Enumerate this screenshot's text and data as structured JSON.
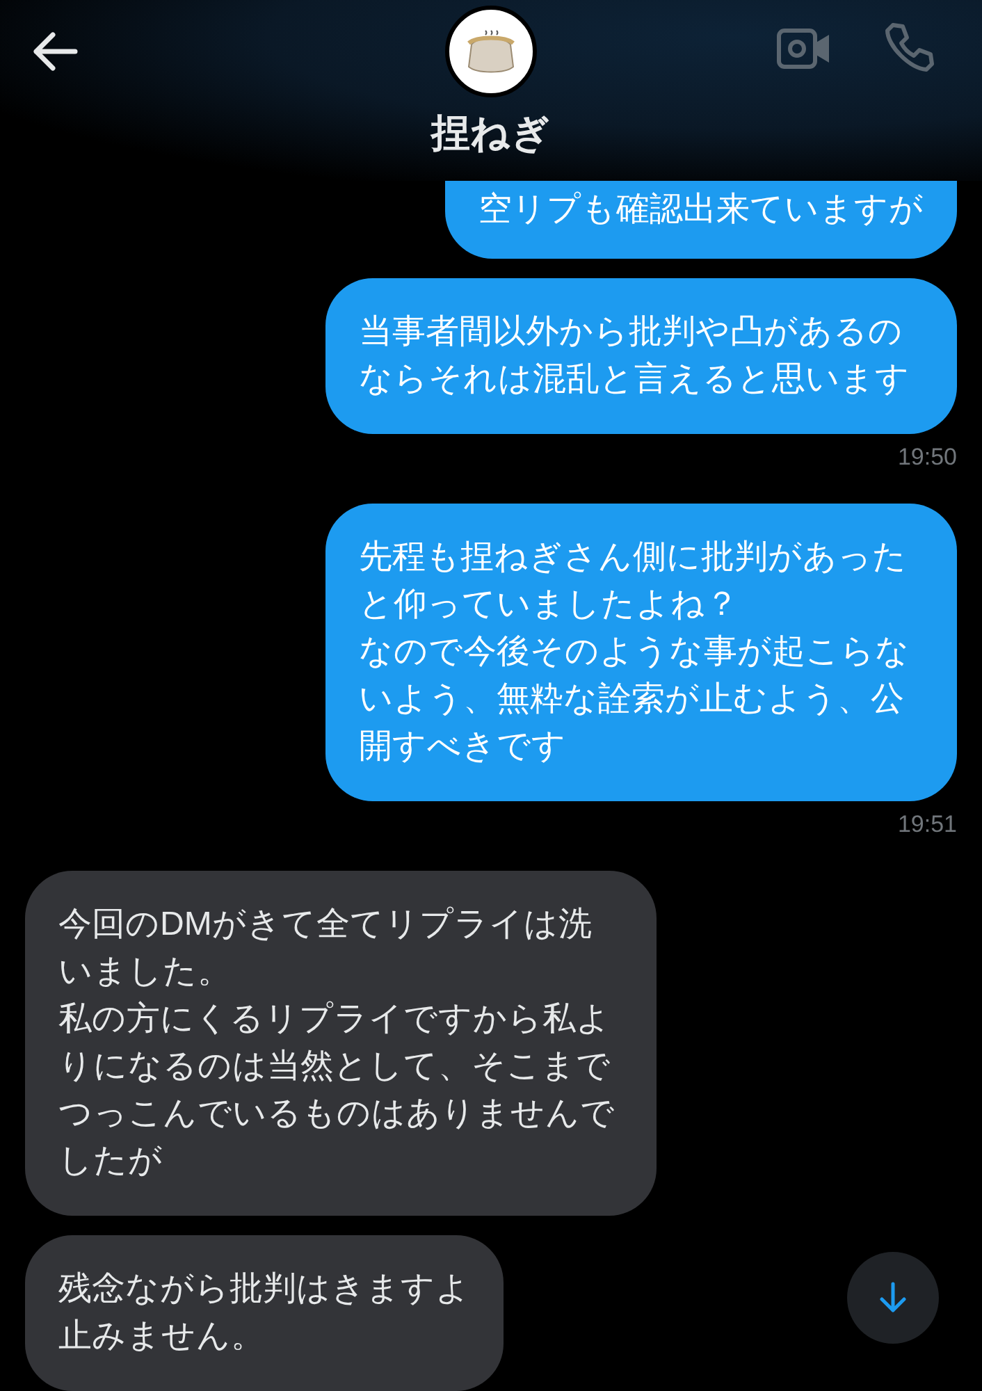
{
  "header": {
    "name": "捏ねぎ"
  },
  "messages": [
    {
      "kind": "sent",
      "paragraphs": [
        "空リプも確認出来ていますが"
      ]
    },
    {
      "kind": "sent",
      "paragraphs": [
        "当事者間以外から批判や凸があるのならそれは混乱と言えると思います"
      ],
      "time": "19:50"
    },
    {
      "kind": "sent",
      "paragraphs": [
        "先程も捏ねぎさん側に批判があったと仰っていましたよね？",
        "なので今後そのような事が起こらないよう、無粋な詮索が止むよう、公開すべきです"
      ],
      "time": "19:51"
    },
    {
      "kind": "received",
      "paragraphs": [
        "今回のDMがきて全てリプライは洗いました。",
        "私の方にくるリプライですから私よりになるのは当然として、そこまでつっこんでいるものはありませんでしたが"
      ]
    },
    {
      "kind": "received",
      "paragraphs": [
        "残念ながら批判はきますよ",
        "止みません。"
      ]
    }
  ]
}
